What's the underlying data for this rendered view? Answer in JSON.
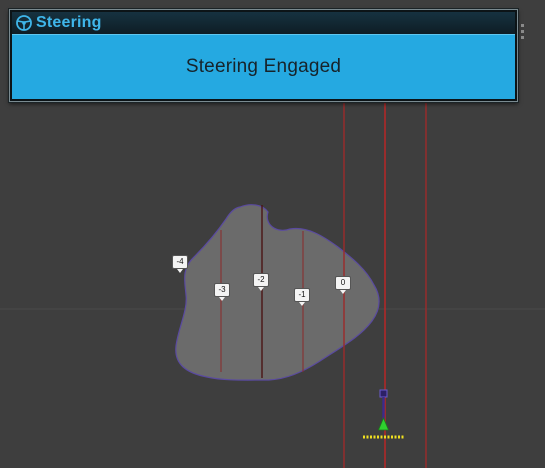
{
  "panel": {
    "title": "Steering",
    "status": "Steering Engaged",
    "icon": "steering-wheel-icon"
  },
  "guidance_lines": {
    "labels": [
      "-4",
      "-3",
      "-2",
      "-1",
      "0"
    ]
  },
  "colors": {
    "panel_title": "#3fb6ea",
    "panel_body": "#25a9e1",
    "guidance_line": "#9c2a2a",
    "field_fill": "#6b6b6b",
    "field_border": "#5a4aa0",
    "tractor_stem": "#3a2c8c",
    "tractor_marker": "#2fcf2f",
    "implement_bar": "#f0e020",
    "background": "#3e3e3e"
  }
}
